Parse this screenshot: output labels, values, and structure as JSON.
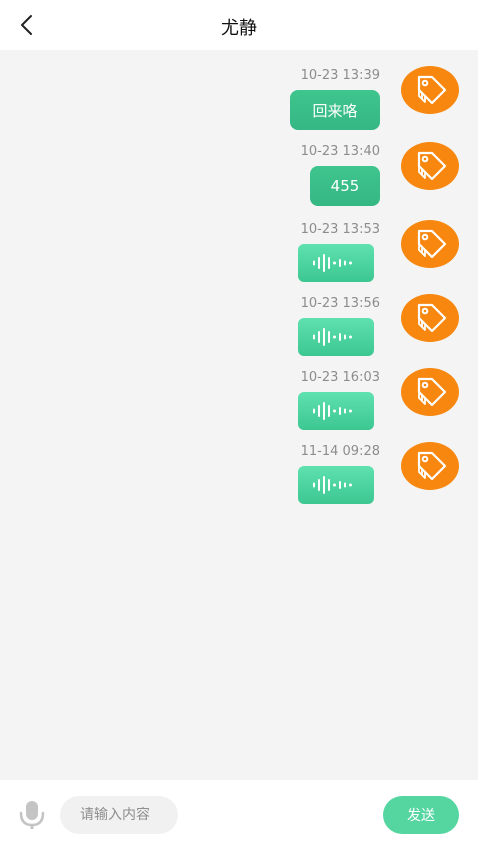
{
  "header": {
    "title": "尤静",
    "back_icon": "chevron-left-icon"
  },
  "messages": [
    {
      "time": "10-23 13:39",
      "type": "text",
      "text": "回来咯"
    },
    {
      "time": "10-23 13:40",
      "type": "text",
      "text": "455"
    },
    {
      "time": "10-23 13:53",
      "type": "voice"
    },
    {
      "time": "10-23 13:56",
      "type": "voice"
    },
    {
      "time": "10-23 16:03",
      "type": "voice"
    },
    {
      "time": "11-14 09:28",
      "type": "voice"
    }
  ],
  "input_bar": {
    "mic_icon": "microphone-icon",
    "placeholder": "请输入内容",
    "send_label": "发送"
  },
  "colors": {
    "accent": "#3fc58e",
    "voice_bubble": "#4fd8a3",
    "avatar": "#f7870f",
    "background": "#f4f4f4",
    "send_button": "#55d6a1"
  }
}
